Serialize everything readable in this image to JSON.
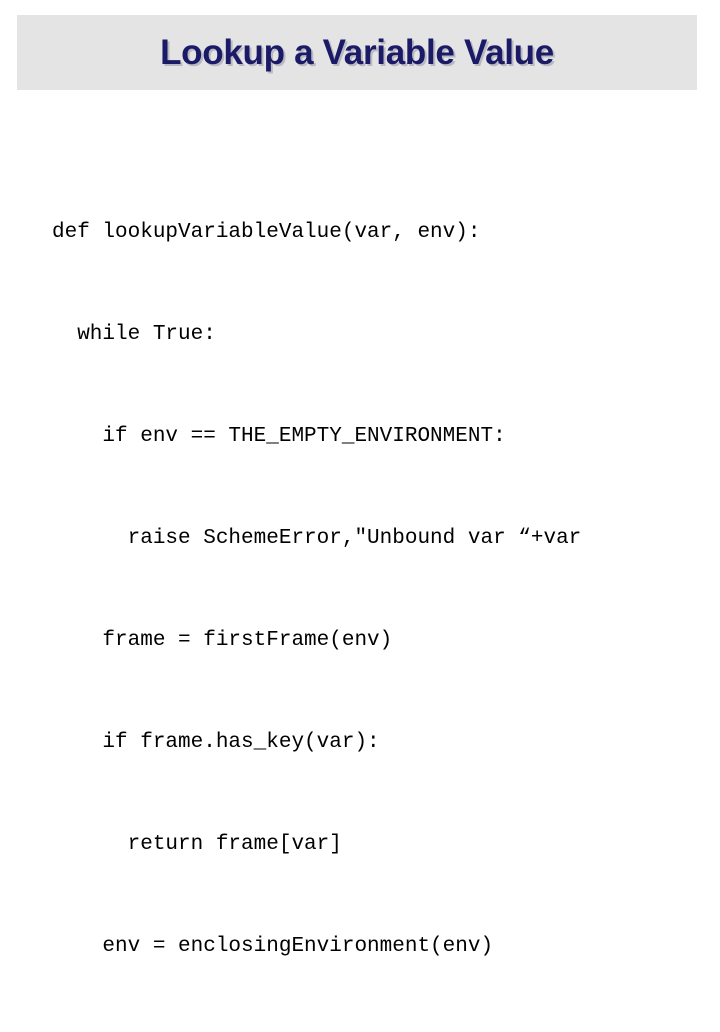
{
  "slide": {
    "title": "Lookup a Variable Value",
    "background_color": "#ffffff",
    "banner_color": "#e4e4e4",
    "title_color": "#1a1a66"
  },
  "code": {
    "language": "python",
    "lines": [
      "def lookupVariableValue(var, env):",
      "  while True:",
      "    if env == THE_EMPTY_ENVIRONMENT:",
      "      raise SchemeError,\"Unbound var “+var",
      "    frame = firstFrame(env)",
      "    if frame.has_key(var):",
      "      return frame[var]",
      "    env = enclosingEnvironment(env)"
    ]
  }
}
